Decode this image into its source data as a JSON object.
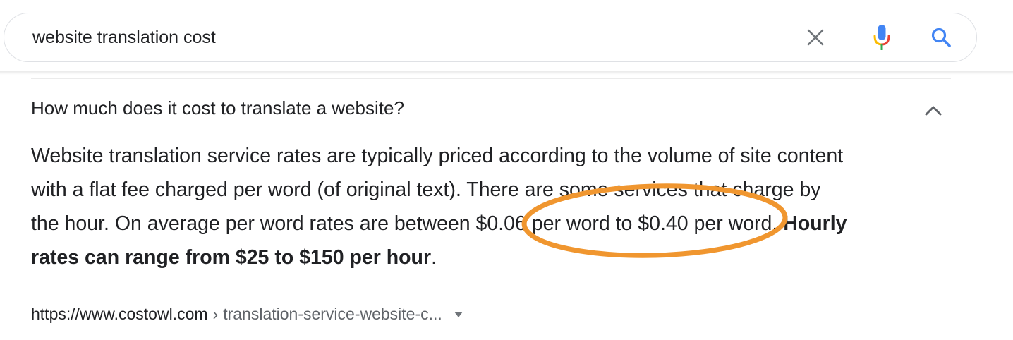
{
  "search": {
    "query": "website translation cost"
  },
  "icons": {
    "clear": "close-icon",
    "voice": "microphone-icon",
    "submit": "search-icon",
    "collapse": "chevron-up-icon",
    "cite_menu": "caret-down-icon"
  },
  "colors": {
    "google_blue": "#4285F4",
    "google_red": "#EA4335",
    "google_yellow": "#FBBC04",
    "google_green": "#34A853",
    "highlight_circle": "#F0962F"
  },
  "result": {
    "question": "How much does it cost to translate a website?",
    "answer": {
      "line1": "Website translation service rates are typically priced according to the volume of site content",
      "line2": "with a flat fee charged per word (of original text). There are some services that charge by",
      "line3": "the hour. On average per word rates are between $0.06 per word to $0.40 per word. ",
      "line3_bold": "Hourly",
      "line4_bold": "rates can range from $25 to $150 per hour",
      "line4_end": "."
    },
    "citation": {
      "domain": "https://www.costowl.com",
      "separator": "›",
      "path": "translation-service-website-c..."
    }
  }
}
